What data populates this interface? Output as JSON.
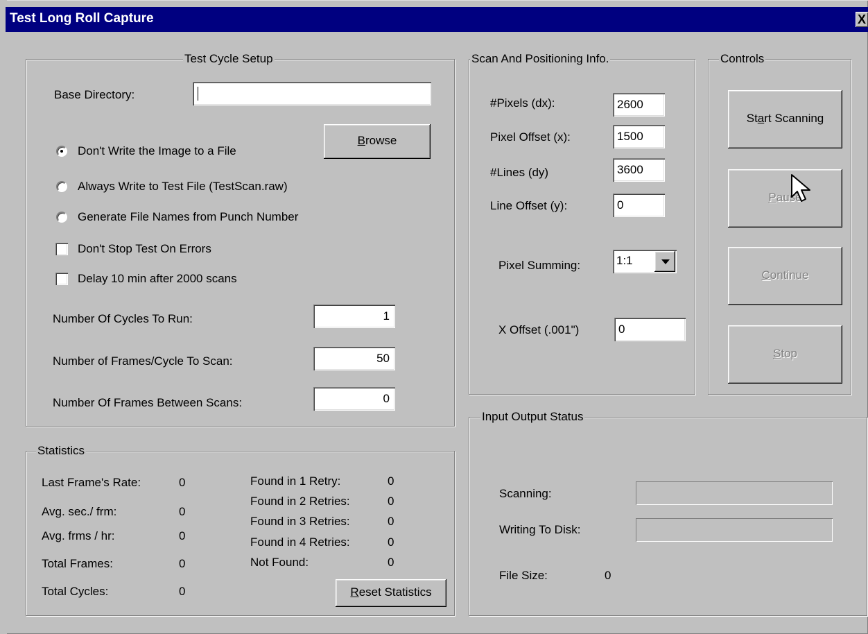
{
  "window": {
    "title": "Test Long Roll Capture",
    "close_glyph": "X"
  },
  "test_cycle_setup": {
    "title": "Test Cycle Setup",
    "base_directory_label": "Base Directory:",
    "base_directory_value": "",
    "browse_label_first": "B",
    "browse_label_rest": "rowse",
    "radio_no_write": "Don't Write the Image to a File",
    "radio_always_write": "Always Write to Test File  (TestScan.raw)",
    "radio_punch_number": "Generate File Names from Punch Number",
    "selected_radio": "no_write",
    "check_dont_stop": "Don't Stop Test On Errors",
    "check_delay": "Delay 10 min after 2000 scans",
    "cycles_label": "Number Of Cycles To Run:",
    "cycles_value": "1",
    "frames_label": "Number of Frames/Cycle To Scan:",
    "frames_value": "50",
    "between_label": "Number Of Frames Between Scans:",
    "between_value": "0"
  },
  "scan_info": {
    "title": "Scan And Positioning Info.",
    "pixels_label": "#Pixels (dx):",
    "pixels_value": "2600",
    "pixel_offset_label": "Pixel Offset (x):",
    "pixel_offset_value": "1500",
    "lines_label": "#Lines  (dy)",
    "lines_value": "3600",
    "line_offset_label": "Line Offset (y):",
    "line_offset_value": "0",
    "summing_label": "Pixel Summing:",
    "summing_value": "1:1",
    "x_offset_label": "X Offset (.001\")",
    "x_offset_value": "0"
  },
  "controls": {
    "title": "Controls",
    "start_pre": "St",
    "start_u": "a",
    "start_post": "rt Scanning",
    "pause_u": "P",
    "pause_post": "ause",
    "continue_u": "C",
    "continue_post": "ontinue",
    "stop_u": "S",
    "stop_post": "top"
  },
  "statistics": {
    "title": "Statistics",
    "last_rate_label": "Last Frame's Rate:",
    "last_rate_value": "0",
    "avg_sec_label": "Avg. sec./ frm:",
    "avg_sec_value": "0",
    "avg_frms_label": "Avg. frms / hr:",
    "avg_frms_value": "0",
    "total_frames_label": "Total Frames:",
    "total_frames_value": "0",
    "total_cycles_label": "Total Cycles:",
    "total_cycles_value": "0",
    "retry1_label": "Found in 1 Retry:",
    "retry1_value": "0",
    "retry2_label": "Found in 2 Retries:",
    "retry2_value": "0",
    "retry3_label": "Found in 3 Retries:",
    "retry3_value": "0",
    "retry4_label": "Found in 4 Retries:",
    "retry4_value": "0",
    "not_found_label": "Not Found:",
    "not_found_value": "0",
    "reset_u": "R",
    "reset_post": "eset Statistics"
  },
  "io_status": {
    "title": "Input Output Status",
    "scanning_label": "Scanning:",
    "scanning_progress": 0,
    "writing_label": "Writing To Disk:",
    "writing_progress": 0,
    "file_size_label": "File Size:",
    "file_size_value": "0"
  }
}
